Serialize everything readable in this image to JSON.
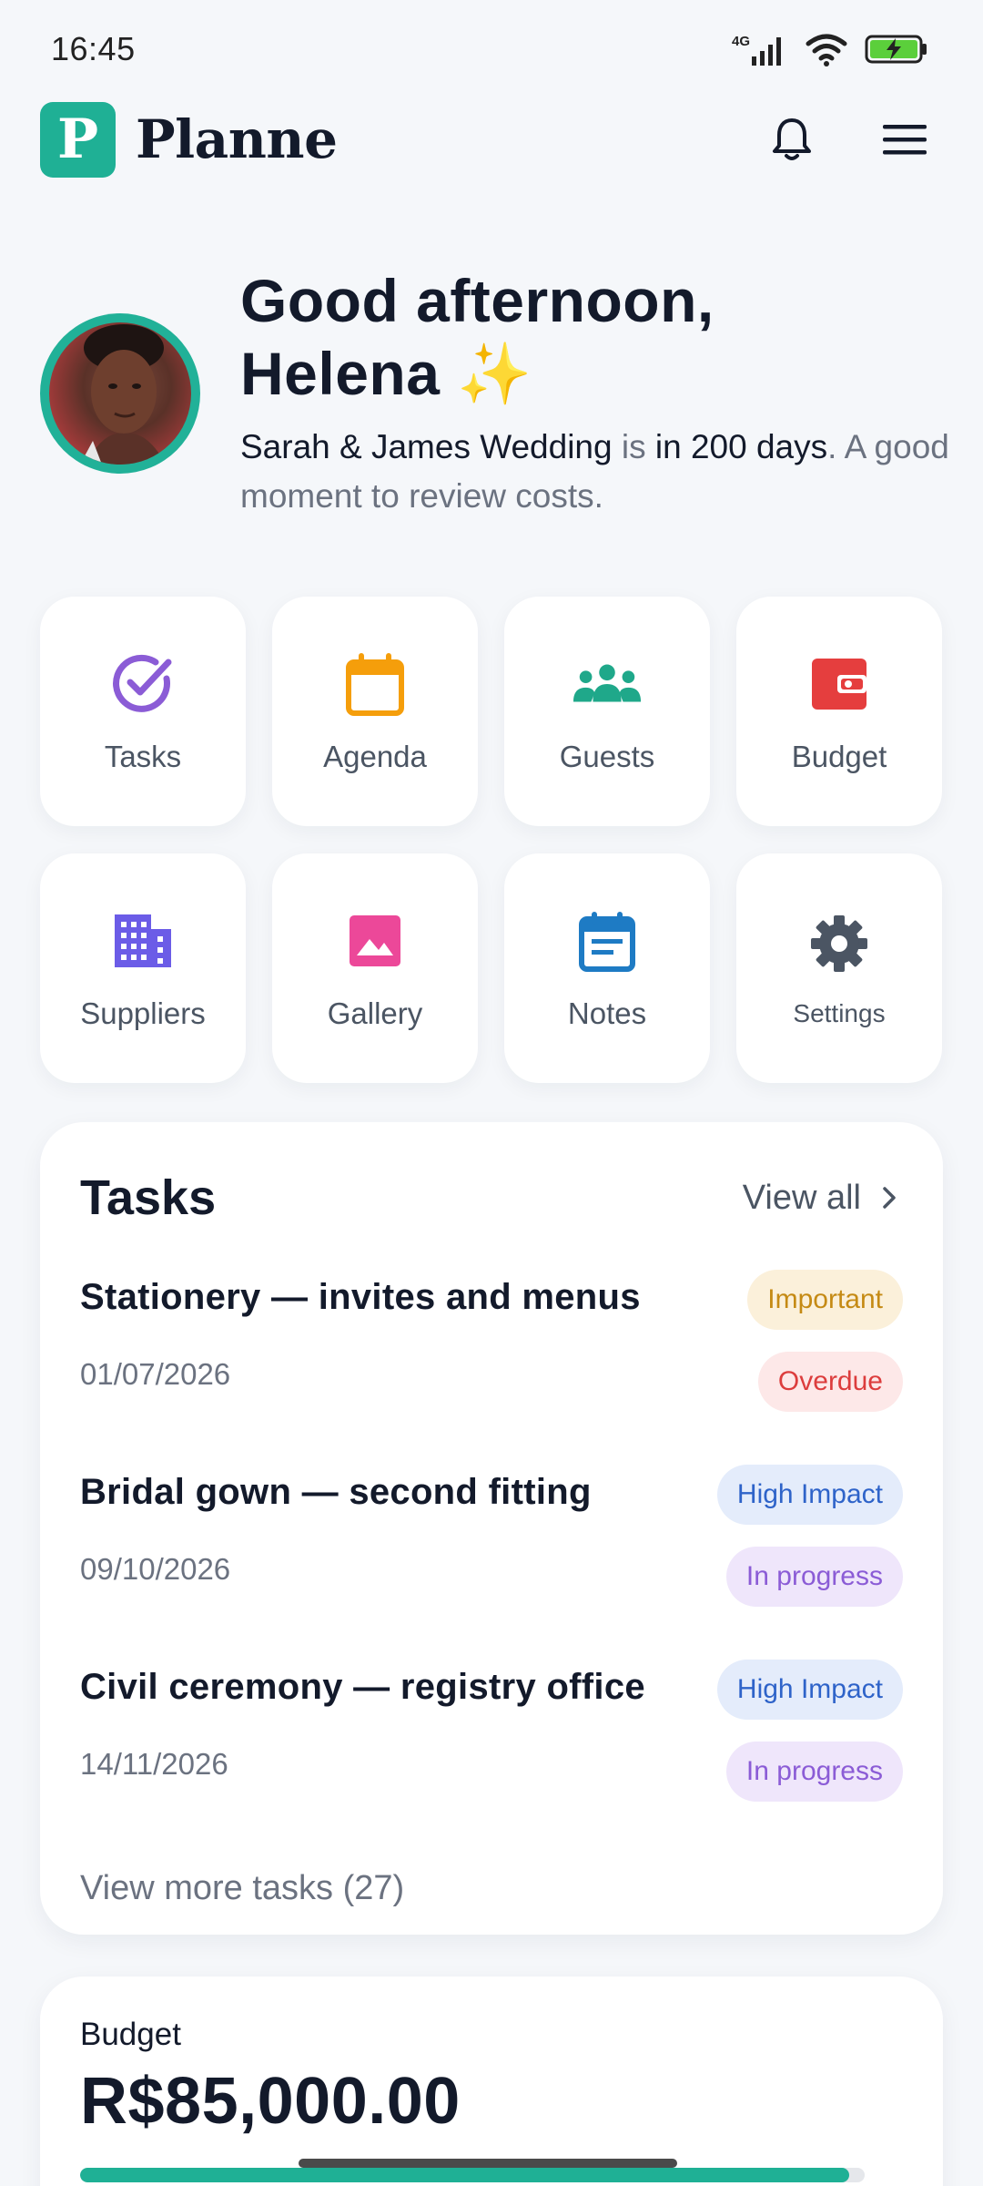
{
  "status_bar": {
    "time": "16:45",
    "network": "4G"
  },
  "header": {
    "logo_letter": "P",
    "app_name": "Planne",
    "notifications_icon": "bell-icon",
    "menu_icon": "hamburger-menu-icon"
  },
  "greeting": {
    "title_line1": "Good afternoon,",
    "title_line2": "Helena ✨",
    "event_name": "Sarah & James Wedding",
    "connector": " is ",
    "countdown": "in 200 days",
    "suffix": ". A good moment to review costs."
  },
  "quick_actions": [
    {
      "label": "Tasks",
      "icon": "check-circle-icon",
      "color": "#8b5cd6"
    },
    {
      "label": "Agenda",
      "icon": "calendar-icon",
      "color": "#f59e0b"
    },
    {
      "label": "Guests",
      "icon": "people-group-icon",
      "color": "#1fa88a"
    },
    {
      "label": "Budget",
      "icon": "wallet-icon",
      "color": "#e53e3e"
    },
    {
      "label": "Suppliers",
      "icon": "building-icon",
      "color": "#6b5ce7"
    },
    {
      "label": "Gallery",
      "icon": "image-icon",
      "color": "#ec4899"
    },
    {
      "label": "Notes",
      "icon": "notes-calendar-icon",
      "color": "#1e7bc4"
    },
    {
      "label": "Settings",
      "icon": "gear-icon",
      "color": "#4b5563"
    }
  ],
  "tasks": {
    "title": "Tasks",
    "view_all": "View all",
    "items": [
      {
        "title": "Stationery — invites and menus",
        "date": "01/07/2026",
        "priority": "Important",
        "status": "Overdue"
      },
      {
        "title": "Bridal gown — second fitting",
        "date": "09/10/2026",
        "priority": "High Impact",
        "status": "In progress"
      },
      {
        "title": "Civil ceremony — registry office",
        "date": "14/11/2026",
        "priority": "High Impact",
        "status": "In progress"
      }
    ],
    "more_label": "View more tasks (27)"
  },
  "budget": {
    "label": "Budget",
    "amount": "R$85,000.00",
    "progress_fraction": 0.98
  }
}
